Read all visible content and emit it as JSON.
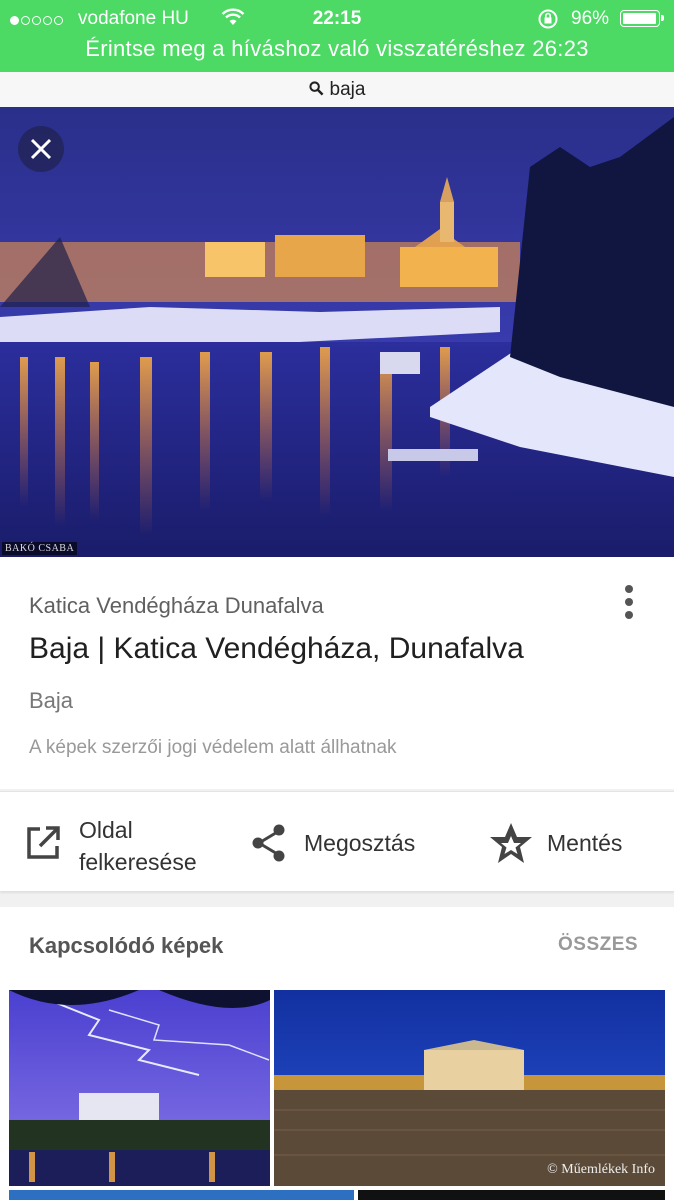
{
  "status_bar": {
    "carrier": "vodafone HU",
    "time": "22:15",
    "battery": "96%",
    "call_banner": "Érintse meg a híváshoz való visszatéréshez 26:23"
  },
  "search": {
    "query": "baja"
  },
  "hero": {
    "credit": "BAKÓ CSABA"
  },
  "result": {
    "source": "Katica Vendégháza Dunafalva",
    "title": "Baja | Katica Vendégháza, Dunafalva",
    "domain": "Baja",
    "copyright_notice": "A képek szerzői jogi védelem alatt állhatnak"
  },
  "actions": {
    "visit_line1": "Oldal",
    "visit_line2": "felkeresése",
    "share": "Megosztás",
    "save": "Mentés"
  },
  "related": {
    "title": "Kapcsolódó képek",
    "all_label": "ÖSSZES",
    "watermark": "© Műemlékek Info"
  },
  "icons": {
    "search": "search-icon",
    "close": "close-icon",
    "more": "more-vert-icon",
    "open": "open-in-new-icon",
    "share": "share-icon",
    "save": "star-badge-icon"
  },
  "colors": {
    "status_bar": "#4cd964"
  }
}
